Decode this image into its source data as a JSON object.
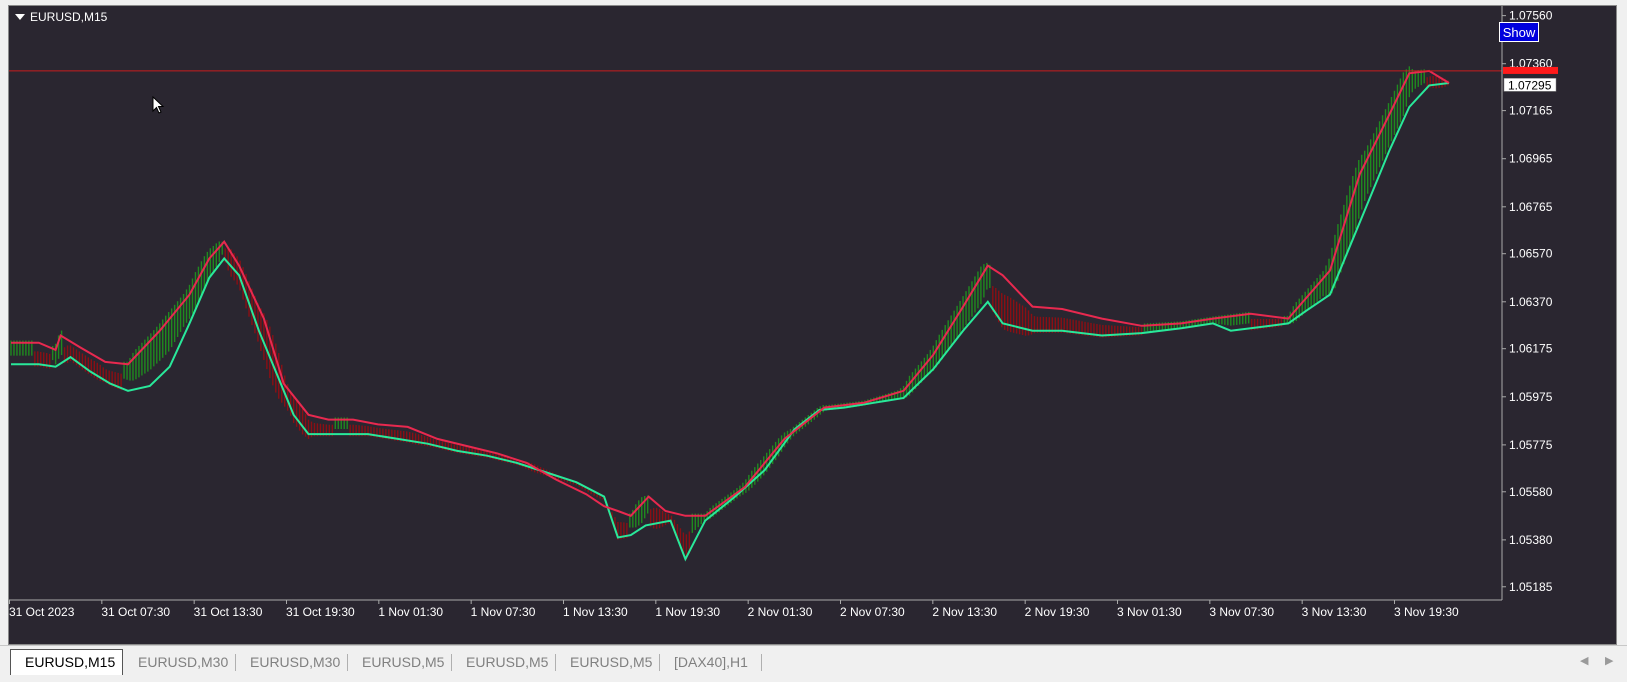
{
  "chart": {
    "symbol_label": "EURUSD,M15",
    "show_button_label": "Show",
    "current_price_label": "1.07295",
    "current_price_value": 1.07295,
    "line_price_value": 1.0733,
    "price_scale": [
      1.0756,
      1.0736,
      1.07165,
      1.06965,
      1.06765,
      1.0657,
      1.0637,
      1.06175,
      1.05975,
      1.05775,
      1.0558,
      1.0538,
      1.05185
    ],
    "price_scale_labels": [
      "1.07560",
      "1.07360",
      "1.07165",
      "1.06965",
      "1.06765",
      "1.06570",
      "1.06370",
      "1.06175",
      "1.05975",
      "1.05775",
      "1.05580",
      "1.05380",
      "1.05185"
    ],
    "time_scale_labels": [
      "31 Oct 2023",
      "31 Oct 07:30",
      "31 Oct 13:30",
      "31 Oct 19:30",
      "1 Nov 01:30",
      "1 Nov 07:30",
      "1 Nov 13:30",
      "1 Nov 19:30",
      "2 Nov 01:30",
      "2 Nov 07:30",
      "2 Nov 13:30",
      "2 Nov 19:30",
      "3 Nov 01:30",
      "3 Nov 07:30",
      "3 Nov 13:30",
      "3 Nov 19:30"
    ],
    "colors": {
      "background": "#2a2630",
      "bull_candle": "#1f8a1f",
      "bear_candle": "#8b0f14",
      "upper_band": "#e8294f",
      "lower_band": "#29e89a",
      "price_line": "#c81e1e",
      "price_tag": "#ff1a1a"
    }
  },
  "chart_data": {
    "type": "line",
    "series": [
      {
        "values": [
          [
            0,
            1.0611
          ],
          [
            28,
            1.0611
          ],
          [
            45,
            1.061
          ],
          [
            60,
            1.0614
          ],
          [
            80,
            1.0608
          ],
          [
            100,
            1.0603
          ],
          [
            118,
            1.06
          ],
          [
            140,
            1.0602
          ],
          [
            160,
            1.061
          ],
          [
            180,
            1.0628
          ],
          [
            200,
            1.0647
          ],
          [
            215,
            1.0655
          ],
          [
            230,
            1.0648
          ],
          [
            250,
            1.0625
          ],
          [
            270,
            1.0605
          ],
          [
            285,
            1.059
          ],
          [
            300,
            1.0582
          ],
          [
            330,
            1.0582
          ],
          [
            360,
            1.0582
          ],
          [
            390,
            1.058
          ],
          [
            420,
            1.0578
          ],
          [
            450,
            1.0575
          ],
          [
            480,
            1.0573
          ],
          [
            510,
            1.057
          ],
          [
            540,
            1.0566
          ],
          [
            570,
            1.0562
          ],
          [
            598,
            1.0556
          ],
          [
            612,
            1.0539
          ],
          [
            625,
            1.054
          ],
          [
            640,
            1.0544
          ],
          [
            665,
            1.0546
          ],
          [
            680,
            1.053
          ],
          [
            700,
            1.0546
          ],
          [
            730,
            1.0556
          ],
          [
            760,
            1.0567
          ],
          [
            790,
            1.0584
          ],
          [
            815,
            1.0592
          ],
          [
            840,
            1.0593
          ],
          [
            870,
            1.0595
          ],
          [
            900,
            1.0597
          ],
          [
            930,
            1.0609
          ],
          [
            960,
            1.0625
          ],
          [
            985,
            1.0637
          ],
          [
            1000,
            1.0628
          ],
          [
            1030,
            1.0625
          ],
          [
            1060,
            1.0625
          ],
          [
            1100,
            1.0623
          ],
          [
            1140,
            1.0624
          ],
          [
            1180,
            1.0626
          ],
          [
            1212,
            1.0628
          ],
          [
            1230,
            1.0625
          ],
          [
            1270,
            1.0627
          ],
          [
            1288,
            1.0628
          ],
          [
            1305,
            1.0633
          ],
          [
            1330,
            1.064
          ],
          [
            1350,
            1.066
          ],
          [
            1370,
            1.068
          ],
          [
            1390,
            1.07
          ],
          [
            1410,
            1.0718
          ],
          [
            1430,
            1.0727
          ],
          [
            1450,
            1.0728
          ]
        ]
      },
      {
        "values": [
          [
            0,
            1.062
          ],
          [
            28,
            1.062
          ],
          [
            45,
            1.0617
          ],
          [
            50,
            1.0623
          ],
          [
            70,
            1.0618
          ],
          [
            95,
            1.0612
          ],
          [
            118,
            1.0611
          ],
          [
            150,
            1.0625
          ],
          [
            180,
            1.064
          ],
          [
            200,
            1.0655
          ],
          [
            215,
            1.0662
          ],
          [
            230,
            1.0652
          ],
          [
            255,
            1.063
          ],
          [
            275,
            1.0603
          ],
          [
            300,
            1.059
          ],
          [
            320,
            1.0588
          ],
          [
            345,
            1.0588
          ],
          [
            370,
            1.0586
          ],
          [
            400,
            1.0585
          ],
          [
            430,
            1.058
          ],
          [
            460,
            1.0577
          ],
          [
            490,
            1.0574
          ],
          [
            520,
            1.057
          ],
          [
            550,
            1.0563
          ],
          [
            580,
            1.0557
          ],
          [
            598,
            1.0552
          ],
          [
            612,
            1.055
          ],
          [
            625,
            1.0548
          ],
          [
            643,
            1.0556
          ],
          [
            660,
            1.055
          ],
          [
            680,
            1.0548
          ],
          [
            700,
            1.0548
          ],
          [
            740,
            1.056
          ],
          [
            780,
            1.058
          ],
          [
            820,
            1.0593
          ],
          [
            860,
            1.0595
          ],
          [
            900,
            1.06
          ],
          [
            930,
            1.0615
          ],
          [
            960,
            1.0635
          ],
          [
            985,
            1.0652
          ],
          [
            1000,
            1.0648
          ],
          [
            1030,
            1.0635
          ],
          [
            1060,
            1.0634
          ],
          [
            1100,
            1.063
          ],
          [
            1140,
            1.0627
          ],
          [
            1180,
            1.0628
          ],
          [
            1212,
            1.063
          ],
          [
            1250,
            1.0632
          ],
          [
            1288,
            1.063
          ],
          [
            1330,
            1.065
          ],
          [
            1360,
            1.069
          ],
          [
            1390,
            1.0715
          ],
          [
            1410,
            1.0732
          ],
          [
            1430,
            1.0733
          ],
          [
            1450,
            1.0728
          ]
        ]
      }
    ],
    "xlim": [
      0,
      1450
    ],
    "ylim": [
      1.0513,
      1.076
    ]
  },
  "tabs": [
    {
      "label": "EURUSD,M15",
      "active": true
    },
    {
      "label": "EURUSD,M30",
      "active": false
    },
    {
      "label": "EURUSD,M30",
      "active": false
    },
    {
      "label": "EURUSD,M5",
      "active": false
    },
    {
      "label": "EURUSD,M5",
      "active": false
    },
    {
      "label": "EURUSD,M5",
      "active": false
    },
    {
      "label": "[DAX40],H1",
      "active": false
    }
  ]
}
